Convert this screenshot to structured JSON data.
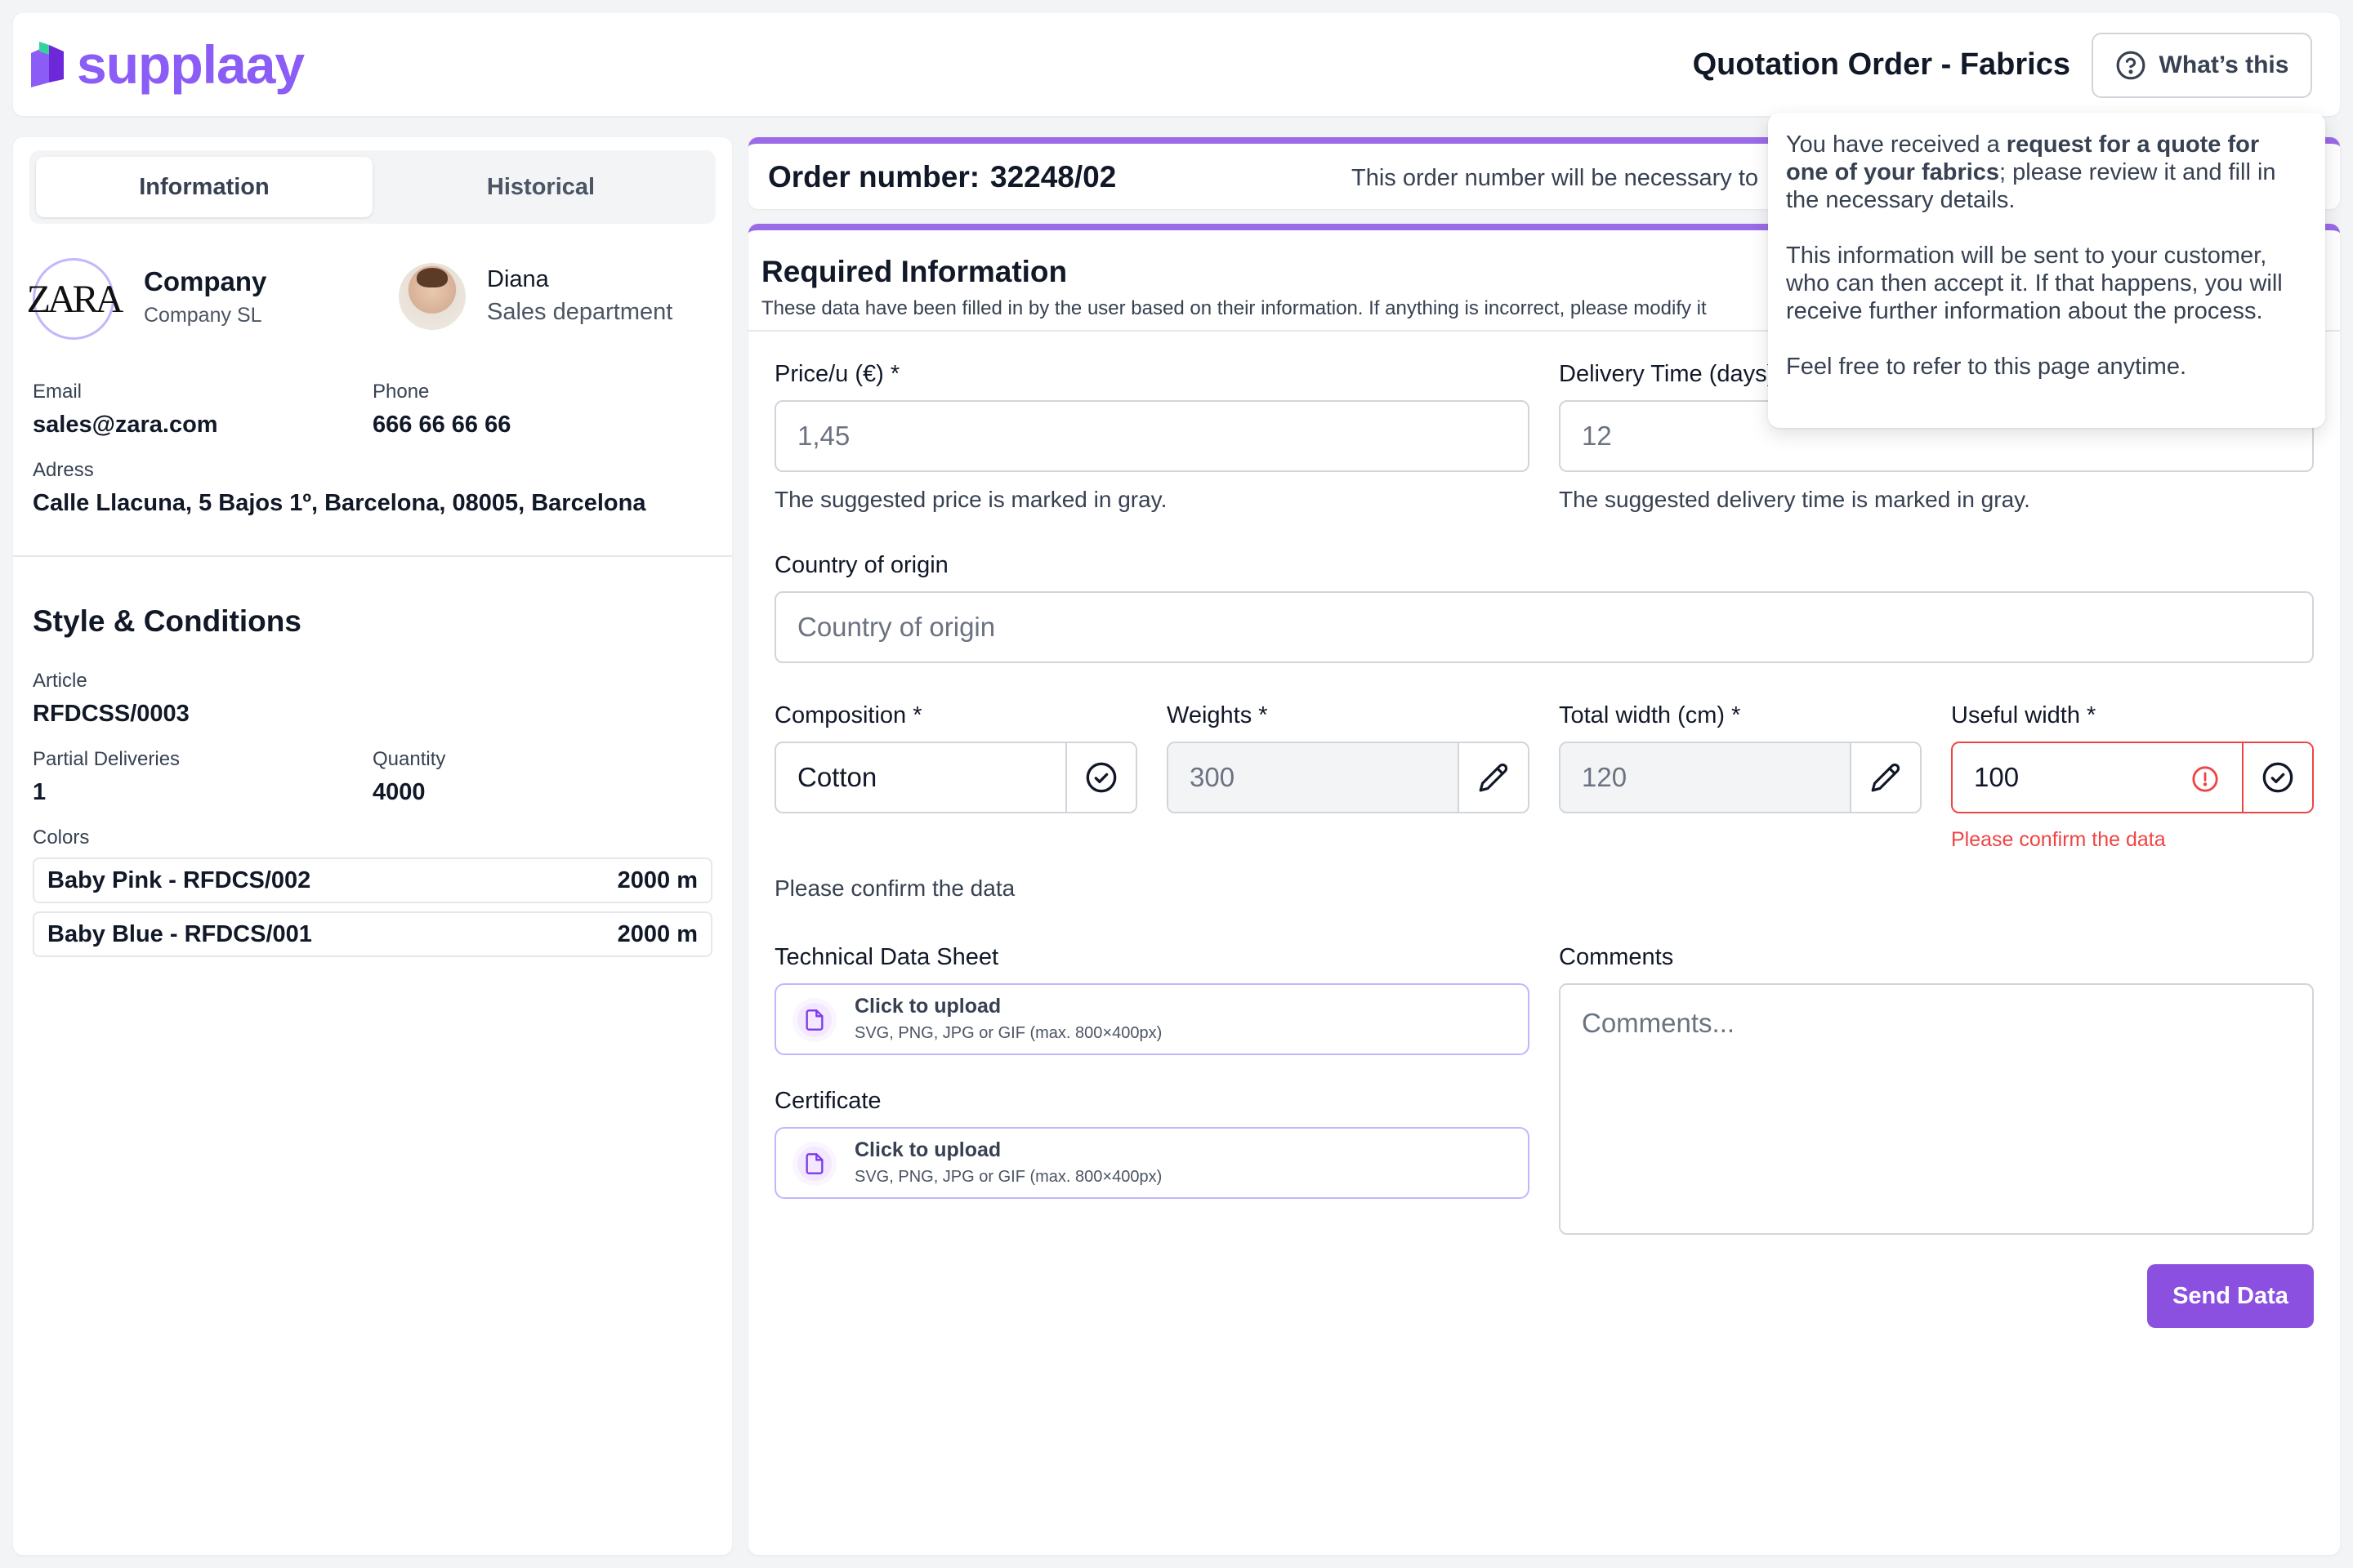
{
  "brand": {
    "name": "supplaay",
    "color": "#8b5cf6"
  },
  "header": {
    "title": "Quotation Order - Fabrics",
    "help_button": "What’s this",
    "help_icon": "question-circle-icon"
  },
  "tabs": [
    {
      "label": "Information",
      "active": true
    },
    {
      "label": "Historical",
      "active": false
    }
  ],
  "company": {
    "logo_text": "ZARA",
    "name": "Company",
    "subtitle": "Company SL"
  },
  "contact": {
    "name": "Diana",
    "department": "Sales department"
  },
  "details": {
    "email_label": "Email",
    "email": "sales@zara.com",
    "phone_label": "Phone",
    "phone": "666 66 66 66",
    "address_label": "Adress",
    "address": "Calle Llacuna, 5 Bajos 1º, Barcelona, 08005, Barcelona"
  },
  "style": {
    "title": "Style & Conditions",
    "article_label": "Article",
    "article": "RFDCSS/0003",
    "partial_label": "Partial Deliveries",
    "partial": "1",
    "quantity_label": "Quantity",
    "quantity": "4000",
    "colors_label": "Colors",
    "colors": [
      {
        "name": "Baby Pink - RFDCS/002",
        "amount": "2000 m"
      },
      {
        "name": "Baby Blue - RFDCS/001",
        "amount": "2000 m"
      }
    ]
  },
  "order": {
    "label": "Order number:",
    "number": "32248/02",
    "hint": "This order number will be necessary to"
  },
  "form": {
    "title": "Required Information",
    "subtitle": "These data have been filled in by the user based on their information. If anything is incorrect, please modify it",
    "price": {
      "label": "Price/u (€) *",
      "placeholder": "1,45",
      "helper": "The suggested price is marked in gray."
    },
    "delivery": {
      "label": "Delivery Time (days)",
      "placeholder": "12",
      "helper": "The suggested delivery time is marked in gray."
    },
    "country": {
      "label": "Country of origin",
      "placeholder": "Country of origin"
    },
    "composition": {
      "label": "Composition *",
      "value": "Cotton"
    },
    "weights": {
      "label": "Weights *",
      "value": "300"
    },
    "total_width": {
      "label": "Total width (cm) *",
      "value": "120"
    },
    "useful_width": {
      "label": "Useful width *",
      "value": "100",
      "error": "Please confirm the data"
    },
    "confirm_note": "Please confirm the data",
    "tech_sheet": {
      "label": "Technical Data Sheet",
      "title": "Click to upload",
      "hint": "SVG, PNG, JPG or GIF (max. 800×400px)"
    },
    "certificate": {
      "label": "Certificate",
      "title": "Click to upload",
      "hint": "SVG, PNG, JPG or GIF (max. 800×400px)"
    },
    "comments": {
      "label": "Comments",
      "placeholder": "Comments..."
    },
    "submit": "Send Data"
  },
  "popover": {
    "p1_pre": "You have received a ",
    "p1_bold": "request for a quote for one of your fabrics",
    "p1_post": "; please review it and fill in the necessary details.",
    "p2": "This information will be sent to your customer, who can then accept it. If that happens, you will receive further information about the process.",
    "p3": "Feel free to refer to this page anytime."
  }
}
